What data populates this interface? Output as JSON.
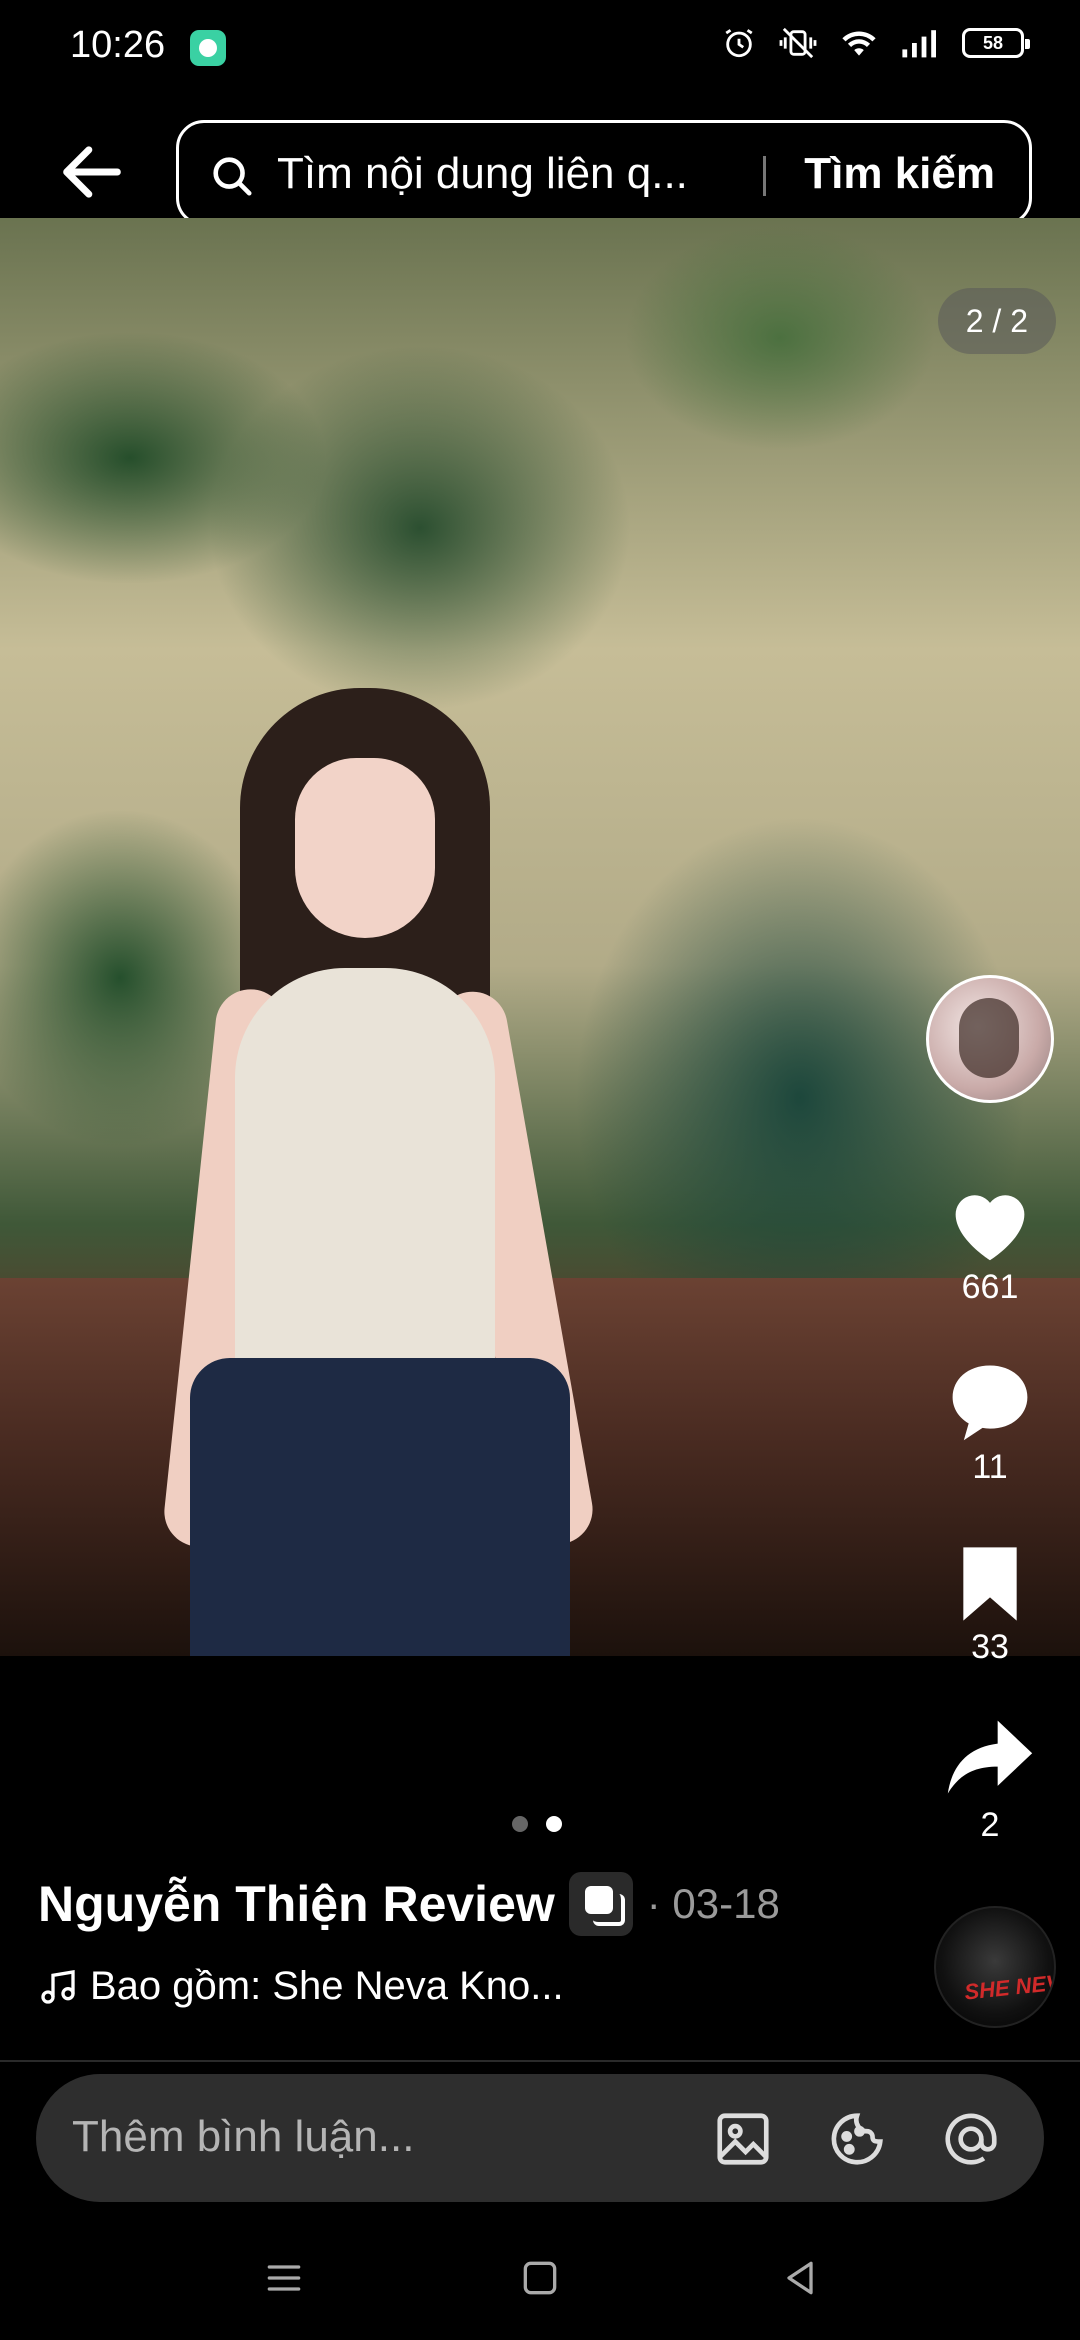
{
  "status_bar": {
    "time": "10:26",
    "battery": "58",
    "icons": [
      "alarm-icon",
      "vibrate-icon",
      "wifi-icon",
      "signal-icon",
      "battery-icon"
    ]
  },
  "header": {
    "search_placeholder": "Tìm nội dung liên q...",
    "search_button": "Tìm kiếm"
  },
  "media": {
    "page_counter": "2 / 2",
    "current_page": 2,
    "total_pages": 2
  },
  "actions": {
    "likes": "661",
    "comments": "11",
    "saves": "33",
    "shares": "2"
  },
  "post": {
    "author": "Nguyễn Thiện Review",
    "date": "· 03-18",
    "music": "Bao gồm: She Neva Kno...",
    "disc_label": "SHE NEVA KNOW"
  },
  "comment": {
    "placeholder": "Thêm bình luận..."
  },
  "colors": {
    "background": "#000000",
    "accent_app": "#3ad1a3",
    "comment_bar": "#2e2e2e"
  }
}
